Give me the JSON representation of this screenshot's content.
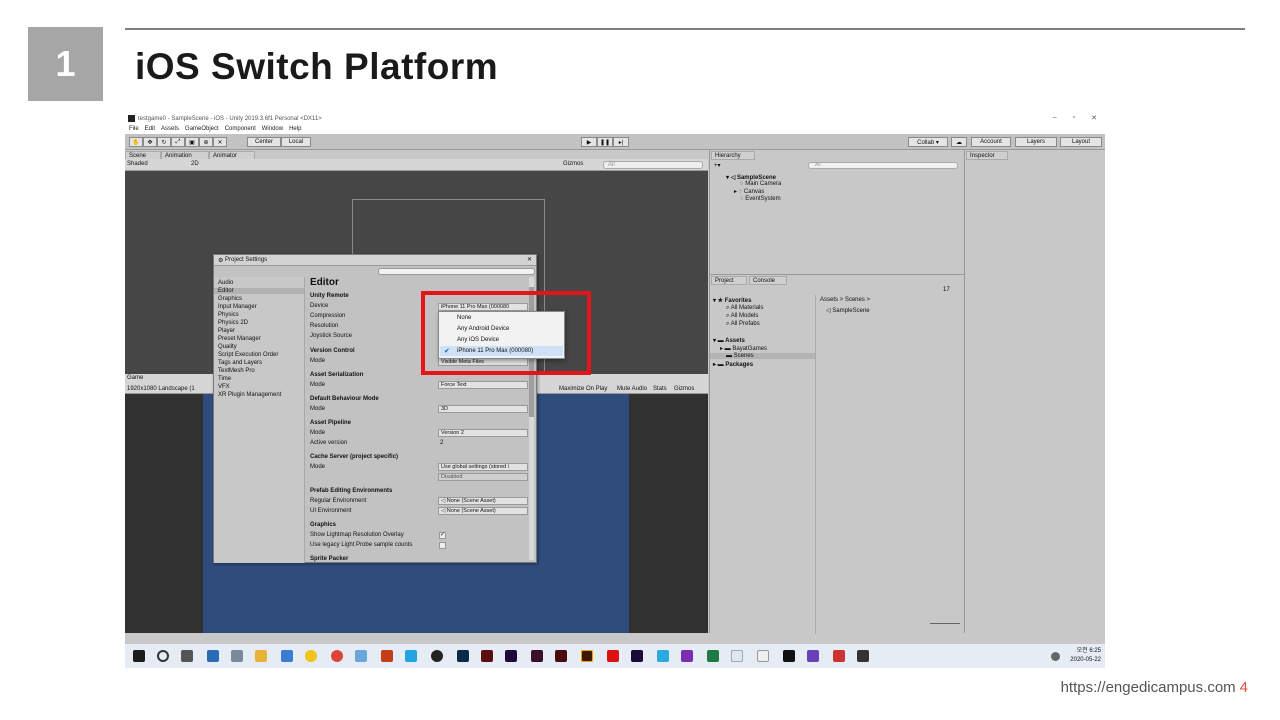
{
  "slide": {
    "number": "1",
    "title": "iOS Switch Platform",
    "footer_url": "https://engedicampus.com",
    "page": "4"
  },
  "window": {
    "title": "testgame0 - SampleScene - iOS - Unity 2019.3.6f1 Personal <DX11>",
    "controls": [
      "–",
      "▫",
      "✕"
    ],
    "menu": [
      "File",
      "Edit",
      "Assets",
      "GameObject",
      "Component",
      "Window",
      "Help"
    ]
  },
  "toolbar": {
    "center": "Center",
    "local": "Local",
    "collab": "Collab ▾",
    "account": "Account",
    "layers": "Layers",
    "layout": "Layout"
  },
  "scene": {
    "tabs": [
      "Scene",
      "Animation",
      "Animator"
    ],
    "shading": "Shaded",
    "mode2d": "2D",
    "gizmos": "Gizmos",
    "search": "All"
  },
  "game": {
    "tab": "Game",
    "resolution": "1920x1080 Landscape (1",
    "options": [
      "Maximize On Play",
      "Mute Audio",
      "Stats",
      "Gizmos"
    ]
  },
  "hierarchy": {
    "tab": "Hierarchy",
    "search": "All",
    "scene": "SampleScene",
    "items": [
      "Main Camera",
      "Canvas",
      "EventSystem"
    ]
  },
  "project": {
    "tabs": [
      "Project",
      "Console"
    ],
    "count": "17",
    "favorites": "Favorites",
    "fav_items": [
      "All Materials",
      "All Models",
      "All Prefabs"
    ],
    "assets": "Assets",
    "asset_items": [
      "BayatGames",
      "Scenes"
    ],
    "packages": "Packages",
    "breadcrumb": "Assets > Scenes >",
    "files": [
      "SampleScene"
    ]
  },
  "inspector": {
    "tab": "Inspector"
  },
  "project_settings": {
    "title": "Project Settings",
    "sidebar": [
      "Audio",
      "Editor",
      "Graphics",
      "Input Manager",
      "Physics",
      "Physics 2D",
      "Player",
      "Preset Manager",
      "Quality",
      "Script Execution Order",
      "Tags and Layers",
      "TextMesh Pro",
      "Time",
      "VFX",
      "XR Plugin Management"
    ],
    "selected": "Editor",
    "heading": "Editor",
    "unity_remote": {
      "header": "Unity Remote",
      "device_label": "Device",
      "device_value": "iPhone 11 Pro Max (000080",
      "compression_label": "Compression",
      "resolution_label": "Resolution",
      "joystick_label": "Joystick Source"
    },
    "version_control": {
      "header": "Version Control",
      "mode_label": "Mode",
      "mode_value": "Visible Meta Files"
    },
    "asset_serialization": {
      "header": "Asset Serialization",
      "mode_label": "Mode",
      "mode_value": "Force Text"
    },
    "default_behaviour": {
      "header": "Default Behaviour Mode",
      "mode_label": "Mode",
      "mode_value": "3D"
    },
    "asset_pipeline": {
      "header": "Asset Pipeline",
      "mode_label": "Mode",
      "mode_value": "Version 2",
      "active_label": "Active version",
      "active_value": "2"
    },
    "cache_server": {
      "header": "Cache Server (project specific)",
      "mode_label": "Mode",
      "mode_value": "Use global settings (stored i",
      "status": "Disabled"
    },
    "prefab_editing": {
      "header": "Prefab Editing Environments",
      "regular_label": "Regular Environment",
      "regular_value": "None (Scene Asset)",
      "ui_label": "UI Environment",
      "ui_value": "None (Scene Asset)"
    },
    "graphics": {
      "header": "Graphics",
      "overlay_label": "Show Lightmap Resolution Overlay",
      "legacy_label": "Use legacy Light Probe sample counts"
    },
    "sprite_packer": {
      "header": "Sprite Packer"
    }
  },
  "device_dropdown": {
    "options": [
      "None",
      "Any Android Device",
      "Any iOS Device",
      "iPhone 11 Pro Max (000080)"
    ],
    "selected_index": 3
  },
  "taskbar": {
    "time": "오전 6:25",
    "date": "2020-05-22"
  },
  "colors": {
    "highlight_box": "#e3151b",
    "number_box": "#a6a6a6",
    "footer_page": "#e84c3d",
    "game_canvas": "#2f4c7c"
  }
}
